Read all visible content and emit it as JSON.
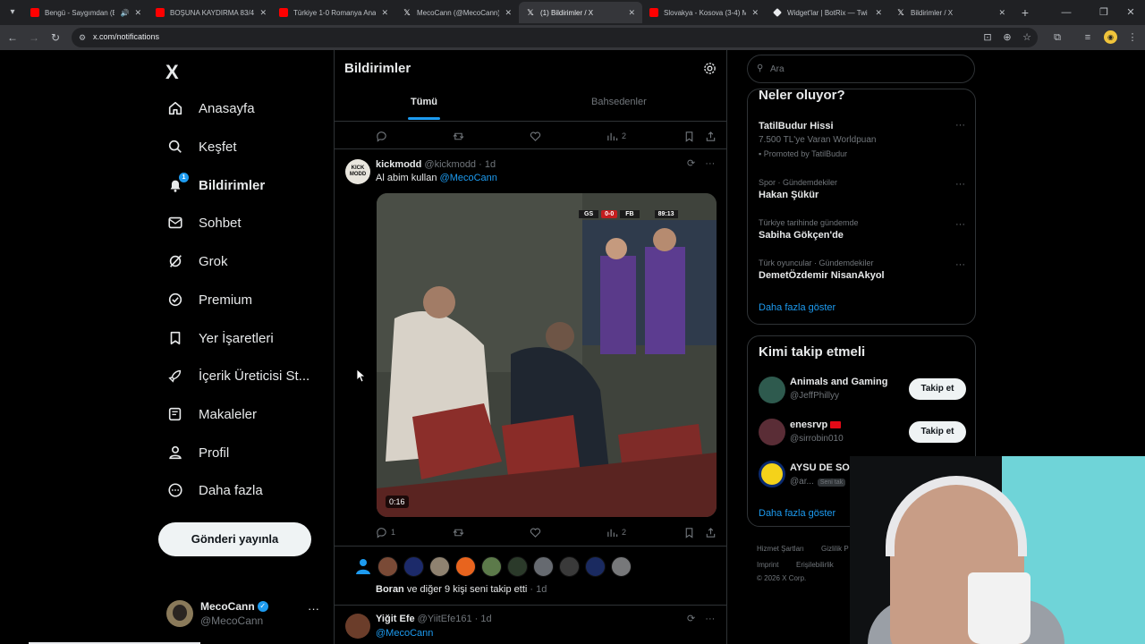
{
  "browser": {
    "tabs": [
      {
        "title": "Bengü - Saygımdan (B",
        "icon": "youtube-icon",
        "sound": true
      },
      {
        "title": "BOŞUNA KAYDIRMA 83/4",
        "icon": "youtube-icon"
      },
      {
        "title": "Türkiye 1-0 Romanya Ana",
        "icon": "youtube-icon"
      },
      {
        "title": "MecoCann (@MecoCann) /",
        "icon": "x-icon"
      },
      {
        "title": "(1) Bildirimler / X",
        "icon": "x-icon",
        "active": true
      },
      {
        "title": "Slovakya - Kosova (3-4) M",
        "icon": "youtube-icon"
      },
      {
        "title": "Widget'lar | BotRix — Twi",
        "icon": "botrix-icon"
      },
      {
        "title": "Bildirimler / X",
        "icon": "x-icon"
      }
    ],
    "url": "x.com/notifications"
  },
  "nav": {
    "logo": "X",
    "items": [
      {
        "label": "Anasayfa"
      },
      {
        "label": "Keşfet"
      },
      {
        "label": "Bildirimler",
        "badge": "1"
      },
      {
        "label": "Sohbet"
      },
      {
        "label": "Grok"
      },
      {
        "label": "Premium"
      },
      {
        "label": "Yer İşaretleri"
      },
      {
        "label": "İçerik Üreticisi St..."
      },
      {
        "label": "Makaleler"
      },
      {
        "label": "Profil"
      },
      {
        "label": "Daha fazla"
      }
    ],
    "post_button": "Gönderi yayınla",
    "account": {
      "name": "MecoCann",
      "handle": "@MecoCann",
      "more": "···"
    }
  },
  "notifications": {
    "title": "Bildirimler",
    "tabs": [
      "Tümü",
      "Bahsedenler"
    ],
    "top_actions": {
      "views": "2"
    },
    "tweet": {
      "name": "kickmodd",
      "handle": "@kickmodd",
      "time": "· 1d",
      "text": "Al abim kullan",
      "mention": "@MecoCann",
      "avatar_text": "KICK MODD",
      "video_duration": "0:16",
      "scoreboard": {
        "home": "GS",
        "score": "0-0",
        "away": "FB",
        "clock": "89:13"
      },
      "replies": "1",
      "views": "2"
    },
    "follow_notice": {
      "name": "Boran",
      "text": " ve diğer 9 kişi seni takip etti",
      "time": " · 1d"
    },
    "tweet2": {
      "name": "Yiğit Efe",
      "handle": "@YiitEfe161",
      "time": "· 1d",
      "mention": "@MecoCann"
    }
  },
  "sidebar": {
    "search_placeholder": "Ara",
    "trends_title": "Neler oluyor?",
    "trends": [
      {
        "context": "",
        "name": "TatilBudur Hissi",
        "sub": "7.500 TL'ye Varan Worldpuan",
        "promo": "Promoted by TatilBudur"
      },
      {
        "context": "Spor · Gündemdekiler",
        "name": "Hakan Şükür"
      },
      {
        "context": "Türkiye tarihinde gündemde",
        "name": "Sabiha Gökçen'de"
      },
      {
        "context": "Türk oyuncular · Gündemdekiler",
        "name": "DemetÖzdemir NisanAkyol"
      }
    ],
    "trends_more": "Daha fazla göster",
    "who_title": "Kimi takip etmeli",
    "who": [
      {
        "name": "Animals and Gaming",
        "handle": "@JeffPhillyy",
        "button": "Takip et"
      },
      {
        "name": "enesrvp",
        "handle": "@sirrobin010",
        "button": "Takip et"
      },
      {
        "name": "AYSU DE SOU",
        "handle": "@ar...",
        "follows_you": "Seni tak"
      }
    ],
    "who_more": "Daha fazla göster",
    "footer": [
      "Hizmet Şartları",
      "Gizlilik P",
      "Imprint",
      "Erişilebilirlik",
      "© 2026 X Corp."
    ]
  },
  "colors": {
    "accent": "#1d9bf0",
    "background": "#000000",
    "border": "#2f3336",
    "muted": "#71767b"
  }
}
